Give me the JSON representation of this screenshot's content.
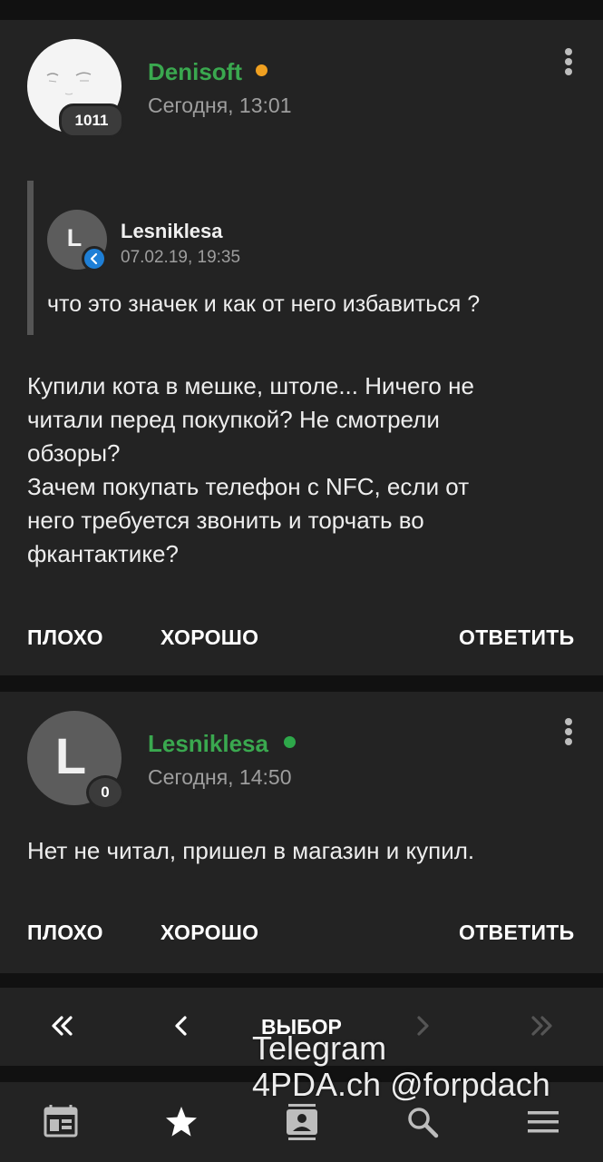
{
  "posts": [
    {
      "author": "Denisoft",
      "status_color": "#f0a020",
      "date": "Сегодня, 13:01",
      "reputation": "1011",
      "quote": {
        "avatar_letter": "L",
        "author": "Lesniklesa",
        "date": "07.02.19, 19:35",
        "text": "что это значек и как от него избавиться ?"
      },
      "body_lines": [
        "Купили кота в мешке, штоле... Ничего не",
        "читали перед покупкой? Не смотрели",
        "обзоры?",
        "Зачем покупать телефон с NFC, если от",
        "него требуется звонить и торчать во",
        "фкантактике?"
      ],
      "actions": {
        "bad": "ПЛОХО",
        "good": "ХОРОШО",
        "reply": "ОТВЕТИТЬ"
      }
    },
    {
      "author": "Lesniklesa",
      "avatar_letter": "L",
      "status_color": "#2ea84a",
      "date": "Сегодня, 14:50",
      "reputation": "0",
      "body_lines": [
        "Нет не читал, пришел в магазин и купил."
      ],
      "actions": {
        "bad": "ПЛОХО",
        "good": "ХОРОШО",
        "reply": "ОТВЕТИТЬ"
      }
    }
  ],
  "pager": {
    "select_label": "ВЫБОР"
  },
  "watermark": {
    "line1": "Telegram",
    "line2": "4PDA.ch @forpdach"
  },
  "bottom_nav": [
    "news-icon",
    "star-icon",
    "contacts-icon",
    "search-icon",
    "menu-icon"
  ],
  "colors": {
    "author_green": "#3aa84f",
    "background": "#232323",
    "accent_blue": "#1e7fd6"
  }
}
